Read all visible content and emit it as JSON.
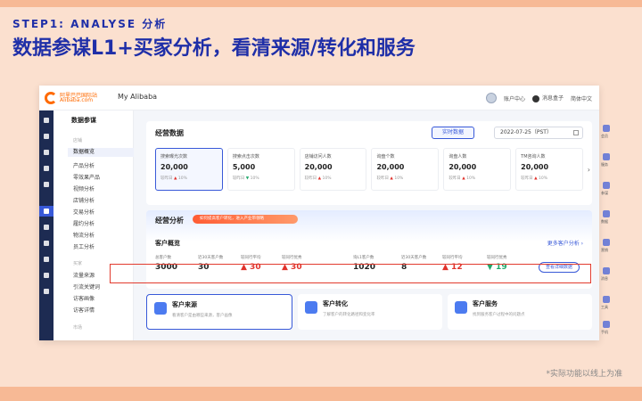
{
  "slide": {
    "step": "STEP1:  ANALYSE  分析",
    "headline": "数据参谋L1+买家分析，看清来源/转化和服务",
    "footnote": "*实际功能以线上为准"
  },
  "app": {
    "logo_cn": "阿里巴巴国际站",
    "logo_en": "Alibaba.com",
    "title": "My Alibaba",
    "account": "账户中心",
    "messages": "消息盒子",
    "language": "简体中文"
  },
  "sidenav": {
    "title": "数据参谋",
    "group1": "店铺",
    "items1": [
      "数据概览",
      "产品分析",
      "零效果产品",
      "视频分析",
      "店铺分析",
      "交易分析",
      "履约分析",
      "物流分析",
      "员工分析"
    ],
    "group2": "买家",
    "items2": [
      "流量来源",
      "引流关键词",
      "访客画像",
      "访客详情"
    ],
    "group3": "市场"
  },
  "operation": {
    "title": "经营数据",
    "realtime_button": "实时数据",
    "date": "2022-07-25（PST）",
    "metrics": [
      {
        "label": "搜索曝光次数",
        "value": "20,000",
        "compare": "较昨日",
        "change": "10%",
        "dir": "up"
      },
      {
        "label": "搜索点击次数",
        "value": "5,000",
        "compare": "较昨日",
        "change": "10%",
        "dir": "down"
      },
      {
        "label": "店铺访问人数",
        "value": "20,000",
        "compare": "较昨日",
        "change": "10%",
        "dir": "up"
      },
      {
        "label": "询盘个数",
        "value": "20,000",
        "compare": "较昨日",
        "change": "10%",
        "dir": "up"
      },
      {
        "label": "询盘人数",
        "value": "20,000",
        "compare": "较昨日",
        "change": "10%",
        "dir": "up"
      },
      {
        "label": "TM咨询人数",
        "value": "20,000",
        "compare": "较昨日",
        "change": "10%",
        "dir": "up"
      }
    ]
  },
  "analysis": {
    "title": "经营分析",
    "banner": "如何提高客户转化，进入产业带领略",
    "customer_title": "客户概览",
    "more_link": "更多客户分析 ›",
    "detail_button": "查看详细数据",
    "cells": [
      {
        "label": "总客户数",
        "value": "3000",
        "style": "normal"
      },
      {
        "label": "近30天客户数",
        "value": "30",
        "style": "normal"
      },
      {
        "label": "较同行平均",
        "value": "▲ 30",
        "style": "red"
      },
      {
        "label": "较同行优秀",
        "value": "▲ 30",
        "style": "red"
      },
      {
        "label": "询L1客户数",
        "value": "1020",
        "style": "normal"
      },
      {
        "label": "近30天客户数",
        "value": "8",
        "style": "normal"
      },
      {
        "label": "较同行平均",
        "value": "▲ 12",
        "style": "red"
      },
      {
        "label": "较同行优秀",
        "value": "▼ 19",
        "style": "green"
      }
    ]
  },
  "bottom_cards": [
    {
      "title": "客户来源",
      "desc": "看清客户是由哪些来源，客户画像"
    },
    {
      "title": "客户转化",
      "desc": "了解客户的转化路径和变化率"
    },
    {
      "title": "客户服务",
      "desc": "找到服务客户过程中的问题点"
    }
  ],
  "right_rail": [
    "会员",
    "服务",
    "参谋",
    "数据",
    "营销",
    "消息",
    "工具",
    "手机"
  ]
}
